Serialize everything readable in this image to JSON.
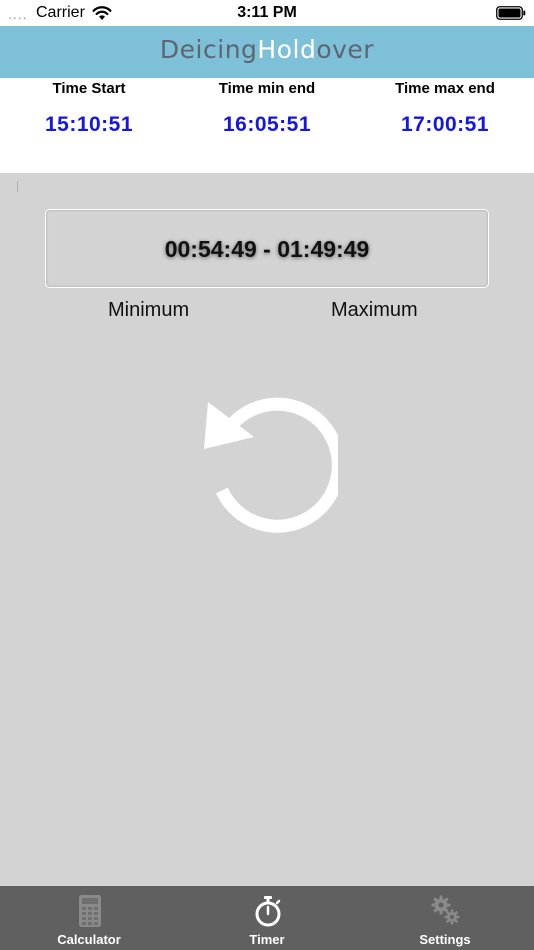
{
  "status_bar": {
    "carrier": "Carrier",
    "time": "3:11 PM",
    "icons": [
      "signal-dots-icon",
      "wifi-icon",
      "battery-icon"
    ]
  },
  "header": {
    "title_part1": "Deicing",
    "title_part2": "Hold",
    "title_part3": "over",
    "background_color": "#7fc0d9"
  },
  "times": {
    "start": {
      "label": "Time Start",
      "value": "15:10:51"
    },
    "min_end": {
      "label": "Time min end",
      "value": "16:05:51"
    },
    "max_end": {
      "label": "Time max end",
      "value": "17:00:51"
    },
    "value_color": "#1515e6"
  },
  "range": {
    "text": "00:54:49 - 01:49:49",
    "minimum_label": "Minimum",
    "maximum_label": "Maximum"
  },
  "reset": {
    "icon": "reset-icon"
  },
  "tabbar": {
    "background_color": "#606060",
    "tabs": [
      {
        "label": "Calculator",
        "icon": "calculator-icon"
      },
      {
        "label": "Timer",
        "icon": "stopwatch-icon"
      },
      {
        "label": "Settings",
        "icon": "gears-icon"
      }
    ]
  }
}
